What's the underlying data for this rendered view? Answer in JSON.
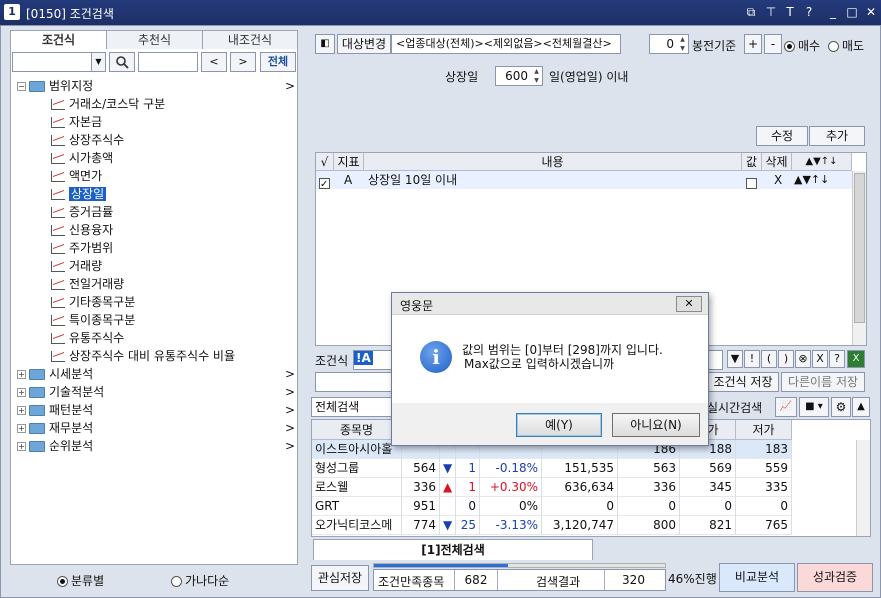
{
  "window": {
    "app_number": "1",
    "title": "[0150] 조건검색",
    "controls": [
      "⧉",
      "⊤",
      "T",
      "?",
      "_",
      "□",
      "✕"
    ]
  },
  "left": {
    "tabs": [
      "조건식",
      "추천식",
      "내조건식"
    ],
    "search_value": "",
    "nav_prev": "<",
    "nav_next": ">",
    "all_button": "전체",
    "tree": {
      "root": "범위지정",
      "children": [
        "거래소/코스닥 구분",
        "자본금",
        "상장주식수",
        "시가총액",
        "액면가",
        "상장일",
        "증거금률",
        "신용융자",
        "주가범위",
        "거래량",
        "전일거래량",
        "기타종목구분",
        "특이종목구분",
        "유통주식수",
        "상장주식수 대비 유통주식수 비율"
      ],
      "selected": "상장일",
      "groups": [
        "시세분석",
        "기술적분석",
        "패턴분석",
        "재무분석",
        "순위분석"
      ]
    },
    "radio": {
      "opt1": "분류별",
      "opt2": "가나다순",
      "selected": "분류별"
    }
  },
  "right": {
    "toolbar": {
      "change_label": "대상변경",
      "target_text": "<업종대상(전체)><제외없음><전체월결산>",
      "day_value": "0",
      "base_label": "봉전기준",
      "plus": "+",
      "minus": "-",
      "buy_label": "매수",
      "sell_label": "매도",
      "trade_selected": "매수"
    },
    "param": {
      "label": "상장일",
      "value": "600",
      "suffix": "일(영업일) 이내"
    },
    "edit_button": "수정",
    "add_button": "추가",
    "cond_table": {
      "headers": [
        "√",
        "지표",
        "내용",
        "값",
        "삭제",
        "▲▼↑↓"
      ],
      "rows": [
        {
          "checked": true,
          "id": "A",
          "content": "상장일 10일 이내",
          "value_checked": false,
          "delete": "X",
          "moves": "▲▼↑↓"
        }
      ]
    },
    "condition_label": "조건식",
    "condition_value": "!A",
    "cond_tools": [
      "▼",
      "!",
      "(",
      ")",
      "⊗",
      "X",
      "?"
    ],
    "save_button": "조건식 저장",
    "saveas_button": "다른이름 저장",
    "result_bar": {
      "mode": "전체검색",
      "realtime": "실시간검색"
    },
    "grid": {
      "headers": [
        "종목명",
        "",
        "",
        "",
        "",
        "",
        "고가",
        "저가"
      ],
      "rows": [
        {
          "name": "이스트아시아홀",
          "price": "",
          "arrow": "",
          "change": "",
          "rate": "",
          "volume": "",
          "open": "186",
          "high": "188",
          "low": "183"
        },
        {
          "name": "형성그룹",
          "price": "564",
          "arrow": "▼",
          "change": "1",
          "rate": "-0.18%",
          "volume": "151,535",
          "open": "563",
          "high": "569",
          "low": "559"
        },
        {
          "name": "로스웰",
          "price": "336",
          "arrow": "▲",
          "change": "1",
          "rate": "+0.30%",
          "volume": "636,634",
          "open": "336",
          "high": "345",
          "low": "335"
        },
        {
          "name": "GRT",
          "price": "951",
          "arrow": "",
          "change": "0",
          "rate": "0%",
          "volume": "0",
          "open": "0",
          "high": "0",
          "low": "0"
        },
        {
          "name": "오가닉티코스메",
          "price": "774",
          "arrow": "▼",
          "change": "25",
          "rate": "-3.13%",
          "volume": "3,120,747",
          "open": "800",
          "high": "821",
          "low": "765"
        }
      ]
    },
    "bottom_tab": "[1]전체검색",
    "status": {
      "watch_save": "관심저장",
      "match_label": "조건만족종목",
      "match_count": "682",
      "result_label": "검색결과",
      "result_count": "320",
      "progress_text": "46%진행",
      "progress": 0.46,
      "compare_button": "비교분석",
      "verify_button": "성과검증"
    }
  },
  "dialog": {
    "title": "영웅문",
    "close": "✕",
    "line1": "값의 범위는 [0]부터 [298]까지 입니다.",
    "line2": "Max값으로 입력하시겠습니까",
    "yes": "예(Y)",
    "no": "아니요(N)"
  },
  "colors": {
    "titlebar": "#1c2f66",
    "selection": "#1c5fc7",
    "up": "#dd1122",
    "down": "#1a3fb0",
    "compare_bg": "#d9e8fb",
    "verify_bg": "#fbd9d9"
  }
}
